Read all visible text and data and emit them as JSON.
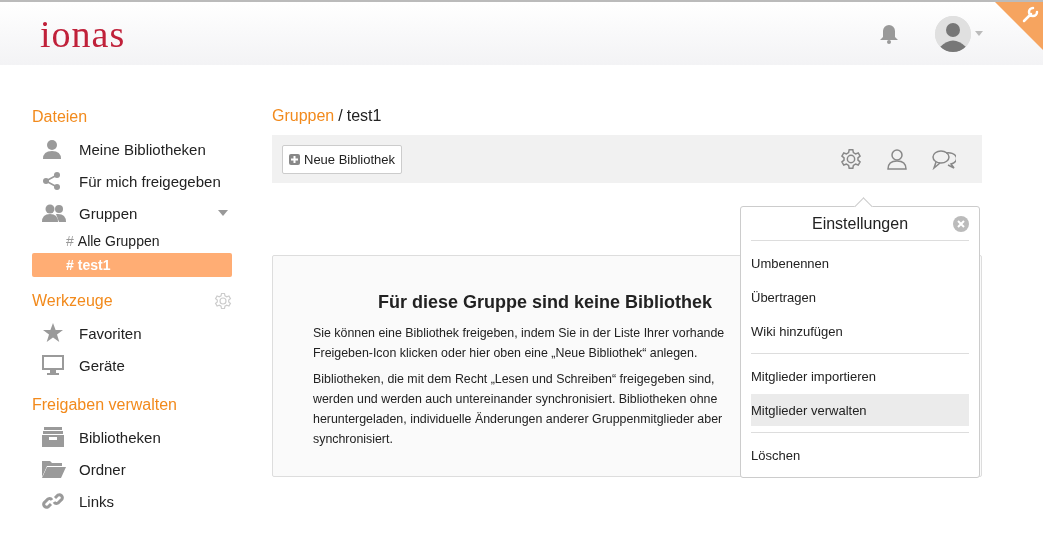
{
  "header": {
    "logo": "ionas"
  },
  "sidebar": {
    "sections": [
      {
        "title": "Dateien",
        "tool": false,
        "items": [
          {
            "label": "Meine Bibliotheken",
            "kind": "person",
            "selected": false
          },
          {
            "label": "Für mich freigegeben",
            "kind": "share",
            "selected": false
          },
          {
            "label": "Gruppen",
            "kind": "group",
            "selected": false,
            "expanded": true,
            "children": [
              {
                "hash": "#",
                "label": "Alle Gruppen",
                "selected": false
              },
              {
                "hash": "#",
                "label": "test1",
                "selected": true
              }
            ]
          }
        ]
      },
      {
        "title": "Werkzeuge",
        "tool": true,
        "items": [
          {
            "label": "Favoriten",
            "kind": "star",
            "selected": false
          },
          {
            "label": "Geräte",
            "kind": "monitor",
            "selected": false
          }
        ]
      },
      {
        "title": "Freigaben verwalten",
        "tool": false,
        "items": [
          {
            "label": "Bibliotheken",
            "kind": "archive",
            "selected": false
          },
          {
            "label": "Ordner",
            "kind": "folder",
            "selected": false
          },
          {
            "label": "Links",
            "kind": "link",
            "selected": false
          }
        ]
      }
    ]
  },
  "breadcrumb": {
    "parent": "Gruppen",
    "separator": "/",
    "current": "test1"
  },
  "toolbar": {
    "new_button": "Neue Bibliothek"
  },
  "empty_state": {
    "title": "Für diese Gruppe sind keine Bibliothek",
    "paragraphs": [
      [
        "Sie können eine Bibliothek freigeben, indem Sie in der Liste Ihrer vorhande",
        "Freigeben-Icon klicken oder hier oben eine „Neue Bibliothek“ anlegen."
      ],
      [
        "Bibliotheken, die mit dem Recht „Lesen und Schreiben“ freigegeben sind,",
        "werden und werden auch untereinander synchronisiert. Bibliotheken ohne",
        "heruntergeladen, individuelle Änderungen anderer Gruppenmitglieder aber",
        "synchronisiert."
      ]
    ]
  },
  "popup": {
    "title": "Einstellungen",
    "groups": [
      [
        {
          "label": "Umbenennen",
          "selected": false
        },
        {
          "label": "Übertragen",
          "selected": false
        },
        {
          "label": "Wiki hinzufügen",
          "selected": false
        }
      ],
      [
        {
          "label": "Mitglieder importieren",
          "selected": false
        },
        {
          "label": "Mitglieder verwalten",
          "selected": true
        }
      ],
      [
        {
          "label": "Löschen",
          "selected": false
        }
      ]
    ]
  }
}
